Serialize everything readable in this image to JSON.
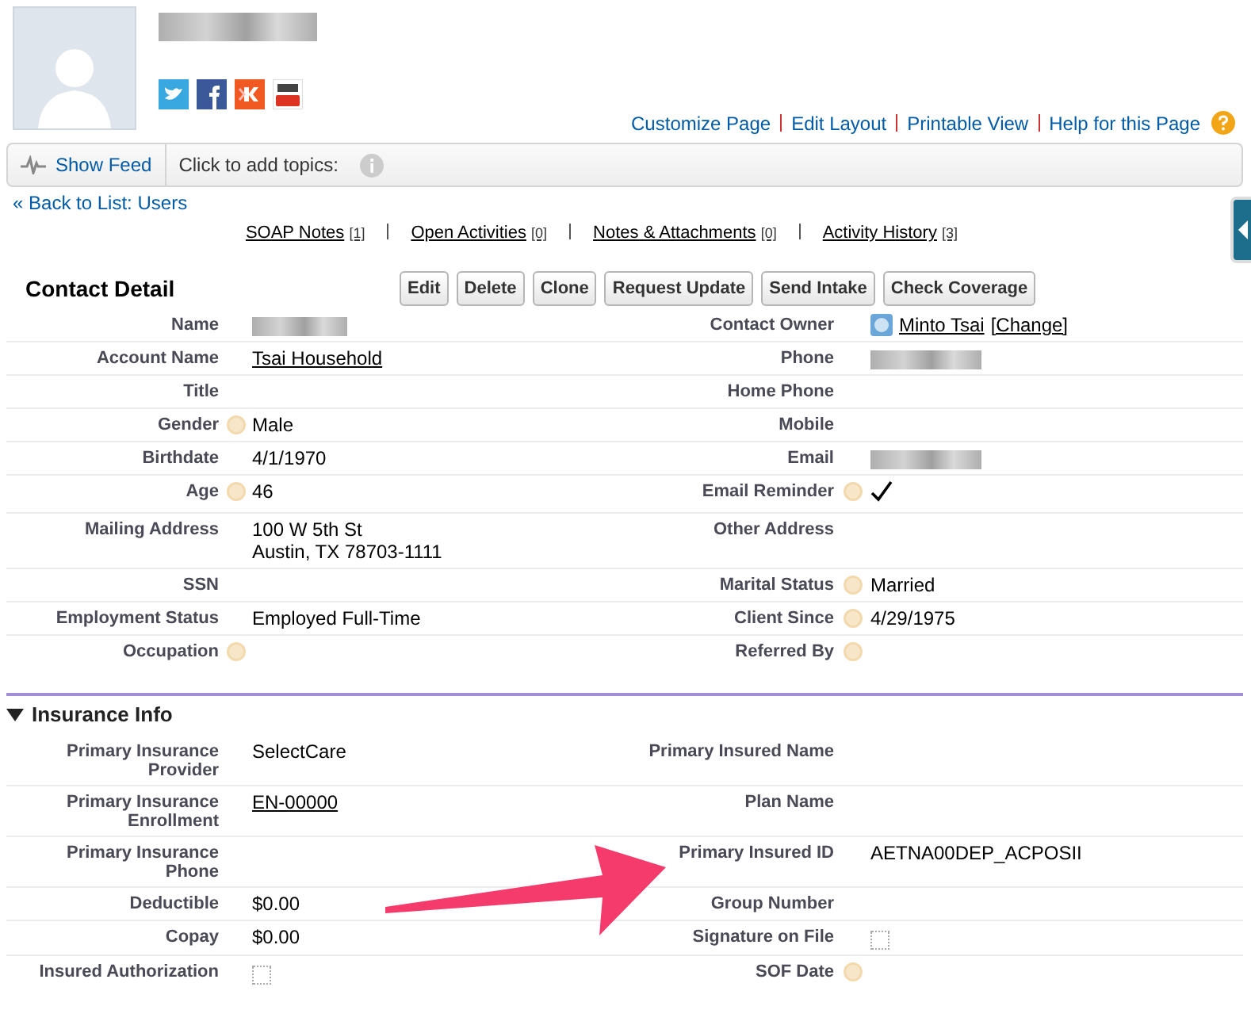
{
  "page_links": [
    "Customize Page",
    "Edit Layout",
    "Printable View",
    "Help for this Page"
  ],
  "feed_bar": {
    "show_feed": "Show Feed",
    "topics": "Click to add topics:"
  },
  "back_link": {
    "prefix": "«",
    "label": "Back to List: Users"
  },
  "related_lists": [
    {
      "label": "SOAP Notes",
      "count": "[1]"
    },
    {
      "label": "Open Activities",
      "count": "[0]"
    },
    {
      "label": "Notes & Attachments",
      "count": "[0]"
    },
    {
      "label": "Activity History",
      "count": "[3]"
    }
  ],
  "contact_detail": {
    "title": "Contact Detail",
    "buttons": [
      "Edit",
      "Delete",
      "Clone",
      "Request Update",
      "Send Intake",
      "Check Coverage"
    ],
    "rows": [
      {
        "left": {
          "label": "Name",
          "kind": "redacted"
        },
        "right": {
          "label": "Contact Owner",
          "kind": "owner",
          "value": "Minto Tsai",
          "action": "[Change]"
        }
      },
      {
        "left": {
          "label": "Account Name",
          "kind": "link",
          "value": "Tsai Household"
        },
        "right": {
          "label": "Phone",
          "kind": "redacted"
        }
      },
      {
        "left": {
          "label": "Title",
          "kind": "text"
        },
        "right": {
          "label": "Home Phone",
          "kind": "text"
        }
      },
      {
        "left": {
          "label": "Gender",
          "help": true,
          "kind": "text",
          "value": "Male"
        },
        "right": {
          "label": "Mobile",
          "kind": "text"
        }
      },
      {
        "left": {
          "label": "Birthdate",
          "kind": "text",
          "value": "4/1/1970"
        },
        "right": {
          "label": "Email",
          "kind": "redacted"
        }
      },
      {
        "left": {
          "label": "Age",
          "help": true,
          "kind": "text",
          "value": "46"
        },
        "right": {
          "label": "Email Reminder",
          "help": true,
          "kind": "checkbox",
          "checked": true
        }
      },
      {
        "left": {
          "label": "Mailing Address",
          "kind": "text",
          "value": "100 W 5th St\nAustin, TX 78703-1111"
        },
        "right": {
          "label": "Other Address",
          "kind": "text"
        }
      },
      {
        "left": {
          "label": "SSN",
          "kind": "text"
        },
        "right": {
          "label": "Marital Status",
          "help": true,
          "kind": "text",
          "value": "Married"
        }
      },
      {
        "left": {
          "label": "Employment Status",
          "kind": "text",
          "value": "Employed Full-Time"
        },
        "right": {
          "label": "Client Since",
          "help": true,
          "kind": "text",
          "value": "4/29/1975"
        }
      },
      {
        "left": {
          "label": "Occupation",
          "help": true,
          "kind": "text"
        },
        "right": {
          "label": "Referred By",
          "help": true,
          "kind": "text"
        }
      }
    ]
  },
  "insurance_info": {
    "title": "Insurance Info",
    "expanded": true,
    "rows": [
      {
        "left": {
          "label": "Primary Insurance Provider",
          "kind": "text",
          "value": "SelectCare"
        },
        "right": {
          "label": "Primary Insured Name",
          "kind": "text"
        }
      },
      {
        "left": {
          "label": "Primary Insurance Enrollment",
          "kind": "link",
          "value": "EN-00000"
        },
        "right": {
          "label": "Plan Name",
          "kind": "text"
        }
      },
      {
        "left": {
          "label": "Primary Insurance Phone",
          "kind": "text"
        },
        "right": {
          "label": "Primary Insured ID",
          "kind": "text",
          "value": "AETNA00DEP_ACPOSII"
        }
      },
      {
        "left": {
          "label": "Deductible",
          "kind": "text",
          "value": "$0.00"
        },
        "right": {
          "label": "Group Number",
          "kind": "text"
        }
      },
      {
        "left": {
          "label": "Copay",
          "kind": "text",
          "value": "$0.00"
        },
        "right": {
          "label": "Signature on File",
          "kind": "checkbox",
          "checked": false
        }
      },
      {
        "left": {
          "label": "Insured Authorization",
          "kind": "checkbox",
          "checked": false
        },
        "right": {
          "label": "SOF Date",
          "help": true,
          "kind": "text"
        }
      }
    ]
  }
}
